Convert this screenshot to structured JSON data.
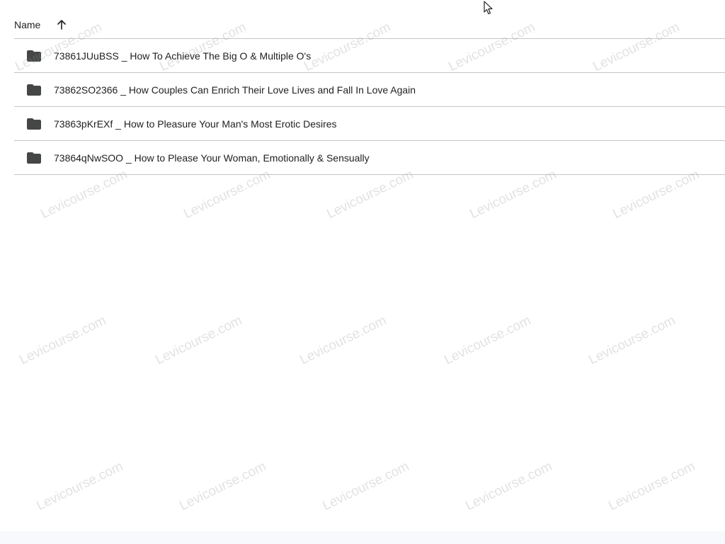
{
  "header": {
    "name_label": "Name",
    "sort_icon": "arrow-up-icon"
  },
  "folders": [
    {
      "name": "73861JUuBSS _ How To Achieve The Big O & Multiple O's",
      "icon": "folder-icon"
    },
    {
      "name": "73862SO2366 _ How Couples Can Enrich Their Love Lives and Fall In Love Again",
      "icon": "folder-icon"
    },
    {
      "name": "73863pKrEXf _ How to Pleasure Your Man's Most Erotic Desires",
      "icon": "folder-icon"
    },
    {
      "name": "73864qNwSOO _ How to Please Your Woman, Emotionally & Sensually",
      "icon": "folder-icon"
    }
  ],
  "watermark": {
    "text": "Levicourse.com"
  },
  "colors": {
    "folder_icon": "#444746",
    "divider": "#c7c7c7",
    "text": "#1f1f1f"
  }
}
